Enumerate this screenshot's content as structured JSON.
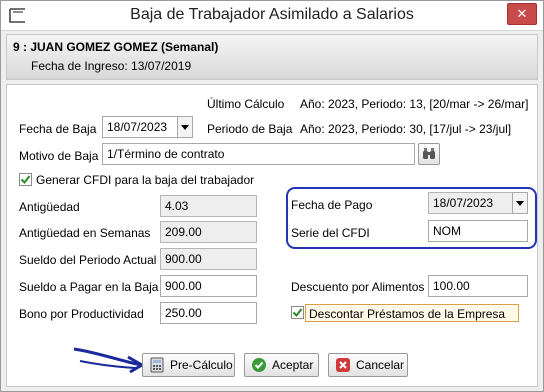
{
  "window": {
    "title": "Baja de Trabajador Asimilado a Salarios",
    "close_glyph": "✕"
  },
  "header": {
    "employee": "9 : JUAN GOMEZ GOMEZ (Semanal)",
    "hire_date": "Fecha de Ingreso: 13/07/2019"
  },
  "calc": {
    "ultimo_label": "Último Cálculo",
    "ultimo_value": "Año: 2023, Periodo: 13, [20/mar -> 26/mar]",
    "periodo_label": "Periodo de Baja",
    "periodo_value": "Año: 2023, Periodo: 30, [17/jul -> 23/jul]"
  },
  "fecha_baja": {
    "label": "Fecha de Baja",
    "value": "18/07/2023"
  },
  "motivo": {
    "label": "Motivo de Baja",
    "value": "1/Término de contrato"
  },
  "cfdi_check": {
    "label": "Generar CFDI para la baja del trabajador",
    "checked": true
  },
  "left_fields": [
    {
      "label": "Antigüedad",
      "value": "4.03"
    },
    {
      "label": "Antigüedad en Semanas",
      "value": "209.00"
    },
    {
      "label": "Sueldo del Periodo Actual",
      "value": "900.00"
    },
    {
      "label": "Sueldo a Pagar en la Baja",
      "value": "900.00"
    },
    {
      "label": "Bono por Productividad",
      "value": "250.00"
    }
  ],
  "pago": {
    "fecha_label": "Fecha de Pago",
    "fecha_value": "18/07/2023",
    "serie_label": "Serie del CFDI",
    "serie_value": "NOM"
  },
  "alimentos": {
    "label": "Descuento por Alimentos",
    "value": "100.00"
  },
  "descontar": {
    "label": "Descontar Préstamos de la Empresa",
    "checked": true
  },
  "buttons": {
    "precalculo": "Pre-Cálculo",
    "aceptar": "Aceptar",
    "cancelar": "Cancelar"
  },
  "colors": {
    "highlight_border": "#2235b5",
    "close_red": "#c74b4b",
    "accept_green": "#3a9a3a",
    "cancel_red": "#d13a3a"
  }
}
